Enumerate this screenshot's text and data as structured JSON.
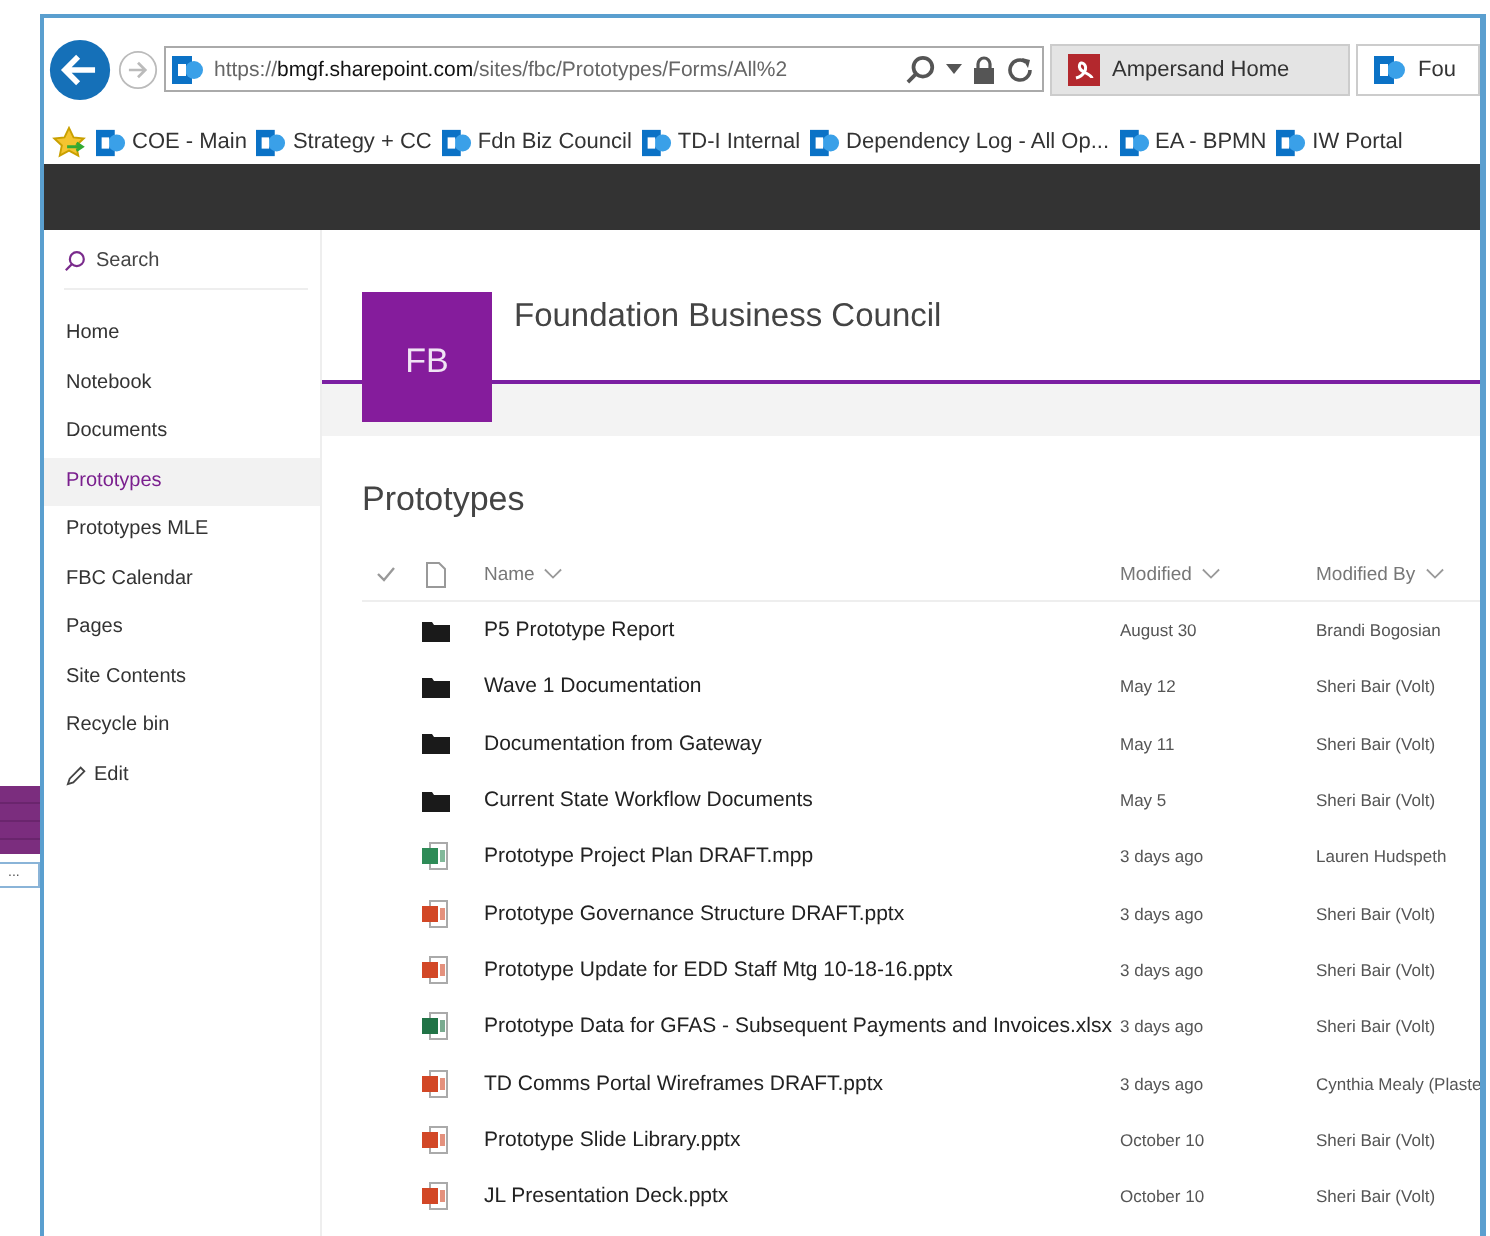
{
  "background_window": {
    "field_text": "..."
  },
  "browser": {
    "address": {
      "scheme": "https://",
      "host": "bmgf.sharepoint.com",
      "path": "/sites/fbc/Prototypes/Forms/All%2"
    },
    "tabs": [
      {
        "label": "Ampersand Home",
        "selected": false,
        "kind": "ampersand"
      },
      {
        "label": "Fou",
        "selected": true,
        "kind": "sharepoint"
      }
    ],
    "favorites": [
      {
        "label": "COE - Main"
      },
      {
        "label": "Strategy + CC"
      },
      {
        "label": "Fdn Biz Council"
      },
      {
        "label": "TD-I Internal"
      },
      {
        "label": "Dependency Log - All Op..."
      },
      {
        "label": "EA - BPMN"
      },
      {
        "label": "IW Portal"
      }
    ]
  },
  "sidebar": {
    "search_placeholder": "Search",
    "items": [
      {
        "label": "Home",
        "selected": false
      },
      {
        "label": "Notebook",
        "selected": false
      },
      {
        "label": "Documents",
        "selected": false
      },
      {
        "label": "Prototypes",
        "selected": true
      },
      {
        "label": "Prototypes MLE",
        "selected": false
      },
      {
        "label": "FBC Calendar",
        "selected": false
      },
      {
        "label": "Pages",
        "selected": false
      },
      {
        "label": "Site Contents",
        "selected": false
      },
      {
        "label": "Recycle bin",
        "selected": false
      }
    ],
    "edit_link": "Edit"
  },
  "site": {
    "logo_initials": "FB",
    "title": "Foundation Business Council"
  },
  "library": {
    "title": "Prototypes",
    "columns": [
      "Name",
      "Modified",
      "Modified By"
    ],
    "rows": [
      {
        "kind": "folder",
        "name": "P5 Prototype Report",
        "modified": "August 30",
        "modified_by": "Brandi Bogosian"
      },
      {
        "kind": "folder",
        "name": "Wave 1 Documentation",
        "modified": "May 12",
        "modified_by": "Sheri Bair (Volt)"
      },
      {
        "kind": "folder",
        "name": "Documentation from Gateway",
        "modified": "May 11",
        "modified_by": "Sheri Bair (Volt)"
      },
      {
        "kind": "folder",
        "name": "Current State Workflow Documents",
        "modified": "May 5",
        "modified_by": "Sheri Bair (Volt)"
      },
      {
        "kind": "project",
        "name": "Prototype Project Plan DRAFT.mpp",
        "modified": "3 days ago",
        "modified_by": "Lauren Hudspeth"
      },
      {
        "kind": "powerpoint",
        "name": "Prototype Governance Structure DRAFT.pptx",
        "modified": "3 days ago",
        "modified_by": "Sheri Bair (Volt)"
      },
      {
        "kind": "powerpoint",
        "name": "Prototype Update for EDD Staff Mtg 10-18-16.pptx",
        "modified": "3 days ago",
        "modified_by": "Sheri Bair (Volt)"
      },
      {
        "kind": "excel",
        "name": "Prototype Data for GFAS - Subsequent Payments and Invoices.xlsx",
        "modified": "3 days ago",
        "modified_by": "Sheri Bair (Volt)"
      },
      {
        "kind": "powerpoint",
        "name": "TD Comms Portal Wireframes DRAFT.pptx",
        "modified": "3 days ago",
        "modified_by": "Cynthia Mealy (Plaste"
      },
      {
        "kind": "powerpoint",
        "name": "Prototype Slide Library.pptx",
        "modified": "October 10",
        "modified_by": "Sheri Bair (Volt)"
      },
      {
        "kind": "powerpoint",
        "name": "JL Presentation Deck.pptx",
        "modified": "October 10",
        "modified_by": "Sheri Bair (Volt)"
      }
    ]
  }
}
